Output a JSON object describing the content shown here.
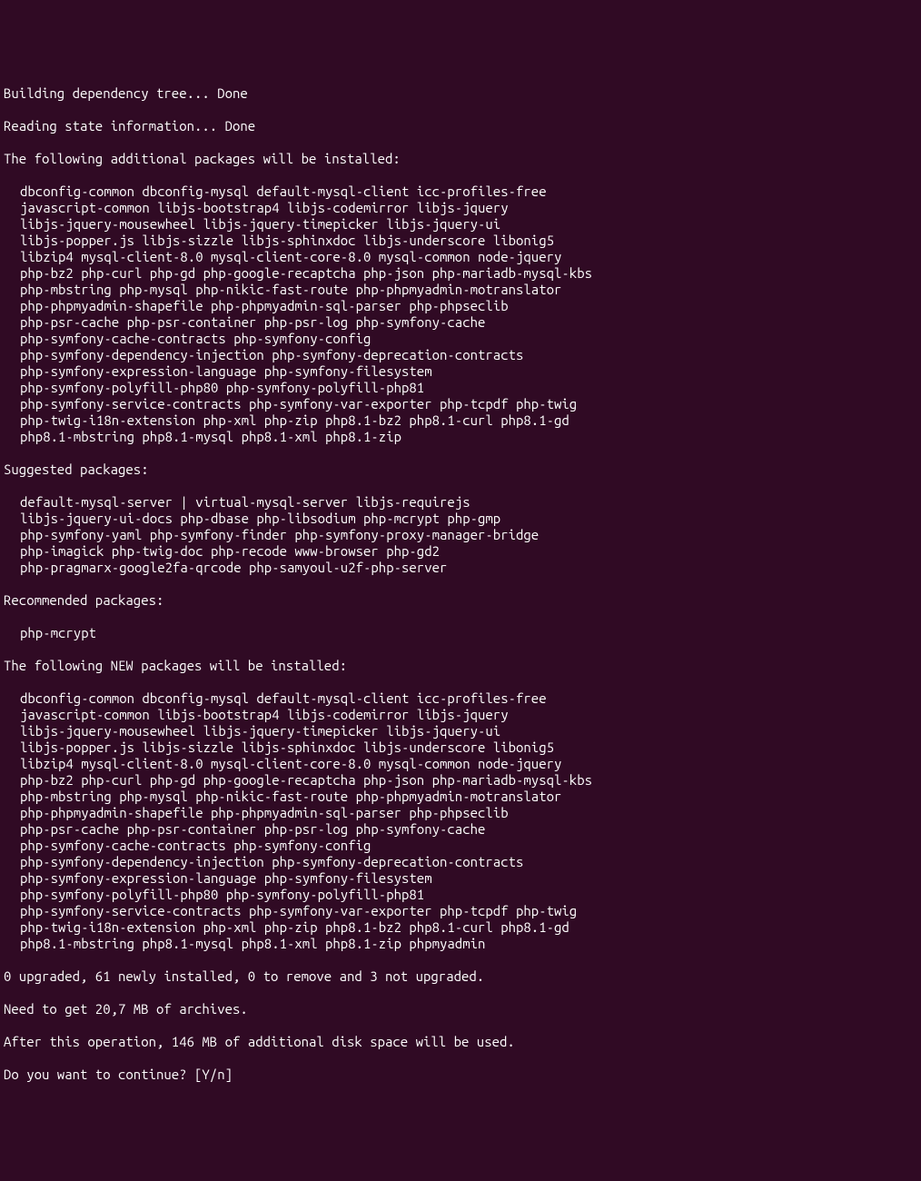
{
  "header": {
    "building": "Building dependency tree... Done",
    "reading": "Reading state information... Done"
  },
  "additional": {
    "title": "The following additional packages will be installed:",
    "lines": [
      "dbconfig-common dbconfig-mysql default-mysql-client icc-profiles-free",
      "javascript-common libjs-bootstrap4 libjs-codemirror libjs-jquery",
      "libjs-jquery-mousewheel libjs-jquery-timepicker libjs-jquery-ui",
      "libjs-popper.js libjs-sizzle libjs-sphinxdoc libjs-underscore libonig5",
      "libzip4 mysql-client-8.0 mysql-client-core-8.0 mysql-common node-jquery",
      "php-bz2 php-curl php-gd php-google-recaptcha php-json php-mariadb-mysql-kbs",
      "php-mbstring php-mysql php-nikic-fast-route php-phpmyadmin-motranslator",
      "php-phpmyadmin-shapefile php-phpmyadmin-sql-parser php-phpseclib",
      "php-psr-cache php-psr-container php-psr-log php-symfony-cache",
      "php-symfony-cache-contracts php-symfony-config",
      "php-symfony-dependency-injection php-symfony-deprecation-contracts",
      "php-symfony-expression-language php-symfony-filesystem",
      "php-symfony-polyfill-php80 php-symfony-polyfill-php81",
      "php-symfony-service-contracts php-symfony-var-exporter php-tcpdf php-twig",
      "php-twig-i18n-extension php-xml php-zip php8.1-bz2 php8.1-curl php8.1-gd",
      "php8.1-mbstring php8.1-mysql php8.1-xml php8.1-zip"
    ]
  },
  "suggested": {
    "title": "Suggested packages:",
    "lines": [
      "default-mysql-server | virtual-mysql-server libjs-requirejs",
      "libjs-jquery-ui-docs php-dbase php-libsodium php-mcrypt php-gmp",
      "php-symfony-yaml php-symfony-finder php-symfony-proxy-manager-bridge",
      "php-imagick php-twig-doc php-recode www-browser php-gd2",
      "php-pragmarx-google2fa-qrcode php-samyoul-u2f-php-server"
    ]
  },
  "recommended": {
    "title": "Recommended packages:",
    "lines": [
      "php-mcrypt"
    ]
  },
  "new_packages": {
    "title": "The following NEW packages will be installed:",
    "lines": [
      "dbconfig-common dbconfig-mysql default-mysql-client icc-profiles-free",
      "javascript-common libjs-bootstrap4 libjs-codemirror libjs-jquery",
      "libjs-jquery-mousewheel libjs-jquery-timepicker libjs-jquery-ui",
      "libjs-popper.js libjs-sizzle libjs-sphinxdoc libjs-underscore libonig5",
      "libzip4 mysql-client-8.0 mysql-client-core-8.0 mysql-common node-jquery",
      "php-bz2 php-curl php-gd php-google-recaptcha php-json php-mariadb-mysql-kbs",
      "php-mbstring php-mysql php-nikic-fast-route php-phpmyadmin-motranslator",
      "php-phpmyadmin-shapefile php-phpmyadmin-sql-parser php-phpseclib",
      "php-psr-cache php-psr-container php-psr-log php-symfony-cache",
      "php-symfony-cache-contracts php-symfony-config",
      "php-symfony-dependency-injection php-symfony-deprecation-contracts",
      "php-symfony-expression-language php-symfony-filesystem",
      "php-symfony-polyfill-php80 php-symfony-polyfill-php81",
      "php-symfony-service-contracts php-symfony-var-exporter php-tcpdf php-twig",
      "php-twig-i18n-extension php-xml php-zip php8.1-bz2 php8.1-curl php8.1-gd",
      "php8.1-mbstring php8.1-mysql php8.1-xml php8.1-zip phpmyadmin"
    ]
  },
  "summary": {
    "upgrade_line": "0 upgraded, 61 newly installed, 0 to remove and 3 not upgraded.",
    "need_get": "Need to get 20,7 MB of archives.",
    "after_op": "After this operation, 146 MB of additional disk space will be used."
  },
  "prompt": {
    "text": "Do you want to continue? [Y/n] "
  }
}
